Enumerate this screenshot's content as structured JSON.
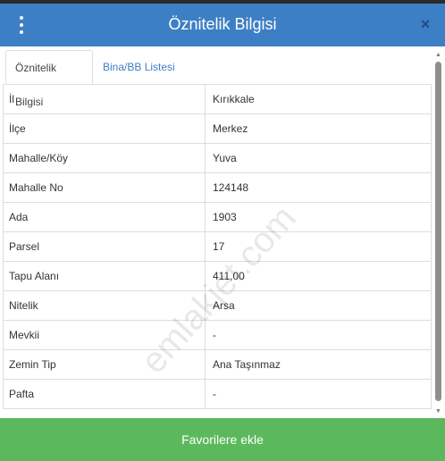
{
  "header": {
    "title": "Öznitelik Bilgisi",
    "close_glyph": "×",
    "menu_icon": "kebab-menu-icon"
  },
  "tabs": [
    {
      "label": "Öznitelik Bilgisi",
      "active": true
    },
    {
      "label": "Bina/BB Listesi",
      "active": false
    }
  ],
  "attributes": [
    {
      "key": "İl",
      "value": "Kırıkkale"
    },
    {
      "key": "İlçe",
      "value": "Merkez"
    },
    {
      "key": "Mahalle/Köy",
      "value": "Yuva"
    },
    {
      "key": "Mahalle No",
      "value": "124148"
    },
    {
      "key": "Ada",
      "value": "1903"
    },
    {
      "key": "Parsel",
      "value": "17"
    },
    {
      "key": "Tapu Alanı",
      "value": "411,00"
    },
    {
      "key": "Nitelik",
      "value": "Arsa"
    },
    {
      "key": "Mevkii",
      "value": "-"
    },
    {
      "key": "Zemin Tip",
      "value": "Ana Taşınmaz"
    },
    {
      "key": "Pafta",
      "value": "-"
    }
  ],
  "watermark": "emlakjet.com",
  "footer": {
    "button_label": "Favorilere ekle"
  },
  "colors": {
    "header": "#3d7fc4",
    "footer": "#5cb85c",
    "tab_link": "#3d7fc4"
  }
}
